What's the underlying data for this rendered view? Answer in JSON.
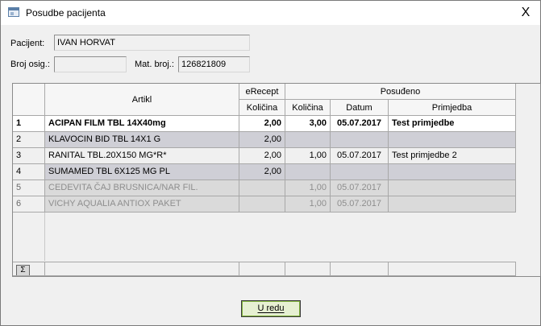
{
  "window": {
    "title": "Posudbe pacijenta",
    "close_glyph": "X"
  },
  "form": {
    "patient_label": "Pacijent:",
    "patient_value": "IVAN HORVAT",
    "insurance_label": "Broj osig.:",
    "insurance_value": "",
    "mat_label": "Mat. broj.:",
    "mat_value": "126821809"
  },
  "table": {
    "headers": {
      "artikl": "Artikl",
      "erecept": "eRecept",
      "posudeno": "Posuđeno",
      "kolicina_erecept": "Količina",
      "kolicina": "Količina",
      "datum": "Datum",
      "primjedba": "Primjedba"
    },
    "rows": [
      {
        "n": "1",
        "artikl": "ACIPAN FILM TBL 14X40mg",
        "erecept": "2,00",
        "kolicina": "3,00",
        "datum": "05.07.2017",
        "primjedba": "Test primjedbe"
      },
      {
        "n": "2",
        "artikl": "KLAVOCIN BID TBL 14X1 G",
        "erecept": "2,00",
        "kolicina": "",
        "datum": "",
        "primjedba": ""
      },
      {
        "n": "3",
        "artikl": "RANITAL TBL.20X150 MG*R*",
        "erecept": "2,00",
        "kolicina": "1,00",
        "datum": "05.07.2017",
        "primjedba": "Test primjedbe 2"
      },
      {
        "n": "4",
        "artikl": "SUMAMED TBL 6X125 MG PL",
        "erecept": "2,00",
        "kolicina": "",
        "datum": "",
        "primjedba": ""
      },
      {
        "n": "5",
        "artikl": "CEDEVITA ČAJ BRUSNICA/NAR FIL.",
        "erecept": "",
        "kolicina": "1,00",
        "datum": "05.07.2017",
        "primjedba": ""
      },
      {
        "n": "6",
        "artikl": "VICHY AQUALIA ANTIOX PAKET",
        "erecept": "",
        "kolicina": "1,00",
        "datum": "05.07.2017",
        "primjedba": ""
      }
    ],
    "sum_symbol": "Σ"
  },
  "buttons": {
    "ok_label": "U redu"
  },
  "colors": {
    "selected_row": "#ffffff",
    "grey_row": "#cfcfd6",
    "dim_row": "#dadada",
    "ok_border": "#7fb13c"
  }
}
